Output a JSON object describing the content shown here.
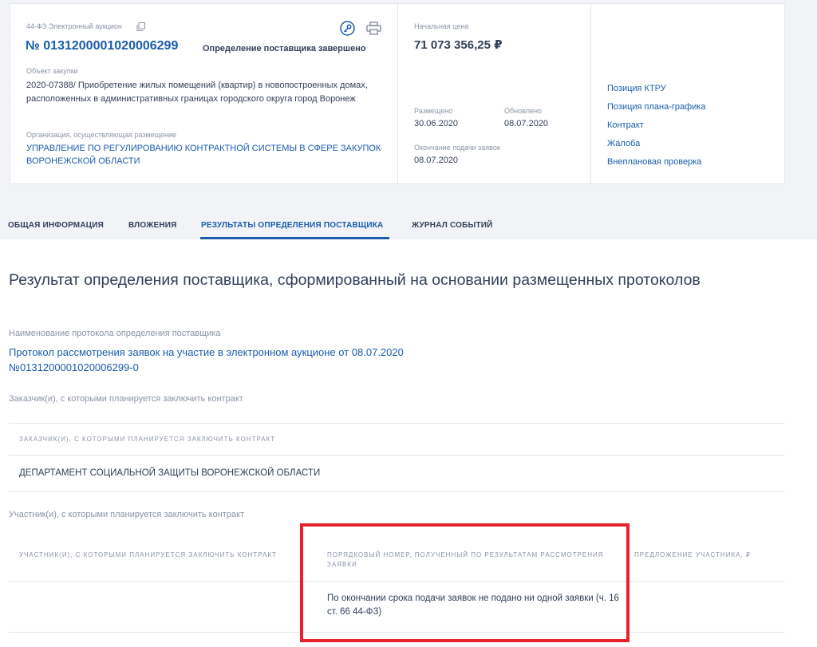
{
  "header": {
    "law_label": "44-ФЗ Электронный аукцион",
    "reg_number": "№ 0131200001020006299",
    "status": "Определение поставщика завершено",
    "object_label": "Объект закупки",
    "object_text": "2020-07388/ Приобретение жилых помещений (квартир) в новопостроенных домах, расположенных в административных границах городского округа город Воронеж",
    "org_label": "Организация, осуществляющая размещение",
    "org_text": "УПРАВЛЕНИЕ ПО РЕГУЛИРОВАНИЮ КОНТРАКТНОЙ СИСТЕМЫ В СФЕРЕ ЗАКУПОК ВОРОНЕЖСКОЙ ОБЛАСТИ",
    "price_label": "Начальная цена",
    "price": "71 073 356,25 ₽",
    "posted_label": "Размещено",
    "posted_date": "30.06.2020",
    "updated_label": "Обновлено",
    "updated_date": "08.07.2020",
    "deadline_label": "Окончание подачи заявок",
    "deadline_date": "08.07.2020",
    "icons": {
      "copy": "copy-icon",
      "key": "key-icon",
      "print": "printer-icon"
    }
  },
  "side_links": [
    "Позиция КТРУ",
    "Позиция плана-графика",
    "Контракт",
    "Жалоба",
    "Внеплановая проверка"
  ],
  "tabs": [
    {
      "label": "ОБЩАЯ ИНФОРМАЦИЯ"
    },
    {
      "label": "ВЛОЖЕНИЯ"
    },
    {
      "label": "РЕЗУЛЬТАТЫ ОПРЕДЕЛЕНИЯ ПОСТАВЩИКА"
    },
    {
      "label": "ЖУРНАЛ СОБЫТИЙ"
    }
  ],
  "active_tab": "РЕЗУЛЬТАТЫ ОПРЕДЕЛЕНИЯ ПОСТАВЩИКА",
  "main": {
    "title": "Результат определения поставщика, сформированный на основании размещенных протоколов",
    "protocol_label": "Наименование протокола определения поставщика",
    "protocol_link": "Протокол рассмотрения заявок на участие в электронном аукционе от 08.07.2020 №0131200001020006299-0",
    "customers_label": "Заказчик(и), с которыми планируется заключить контракт",
    "customers_table": {
      "header": "ЗАКАЗЧИК(И), С КОТОРЫМИ ПЛАНИРУЕТСЯ ЗАКЛЮЧИТЬ КОНТРАКТ",
      "rows": [
        "ДЕПАРТАМЕНТ СОЦИАЛЬНОЙ ЗАЩИТЫ ВОРОНЕЖСКОЙ ОБЛАСТИ"
      ]
    },
    "participants_label": "Участник(и), с которыми планируется заключить контракт",
    "participants_table": {
      "headers": [
        "УЧАСТНИК(И), С КОТОРЫМИ ПЛАНИРУЕТСЯ ЗАКЛЮЧИТЬ КОНТРАКТ",
        "ПОРЯДКОВЫЙ НОМЕР, ПОЛУЧЕННЫЙ ПО РЕЗУЛЬТАТАМ РАССМОТРЕНИЯ ЗАЯВКИ",
        "ПРЕДЛОЖЕНИЕ УЧАСТНИКА, ₽"
      ],
      "row": [
        "",
        "По окончании срока подачи заявок не подано ни одной заявки (ч. 16 ст. 66 44-ФЗ)",
        ""
      ]
    }
  },
  "colors": {
    "link": "#1a5cad",
    "text": "#334059",
    "muted": "#8a93a6",
    "highlight": "#e8212e",
    "page_bg": "#f2f3f6"
  }
}
